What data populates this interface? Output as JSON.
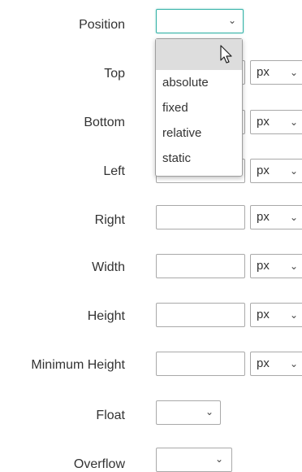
{
  "fields": {
    "position": {
      "label": "Position",
      "value": ""
    },
    "top": {
      "label": "Top",
      "unit": "px"
    },
    "bottom": {
      "label": "Bottom",
      "unit": "px"
    },
    "left": {
      "label": "Left",
      "unit": "px"
    },
    "right": {
      "label": "Right",
      "unit": "px"
    },
    "width": {
      "label": "Width",
      "unit": "px"
    },
    "height": {
      "label": "Height",
      "unit": "px"
    },
    "min_height": {
      "label": "Minimum Height",
      "unit": "px"
    },
    "float": {
      "label": "Float",
      "value": ""
    },
    "overflow": {
      "label": "Overflow",
      "value": ""
    }
  },
  "dropdown": {
    "options": [
      "",
      "absolute",
      "fixed",
      "relative",
      "static"
    ]
  },
  "icons": {
    "chevron": "chevron-down-icon",
    "cursor": "mouse-pointer-icon"
  },
  "colors": {
    "focus_border": "#36b3a8",
    "highlight": "#dddddd"
  }
}
